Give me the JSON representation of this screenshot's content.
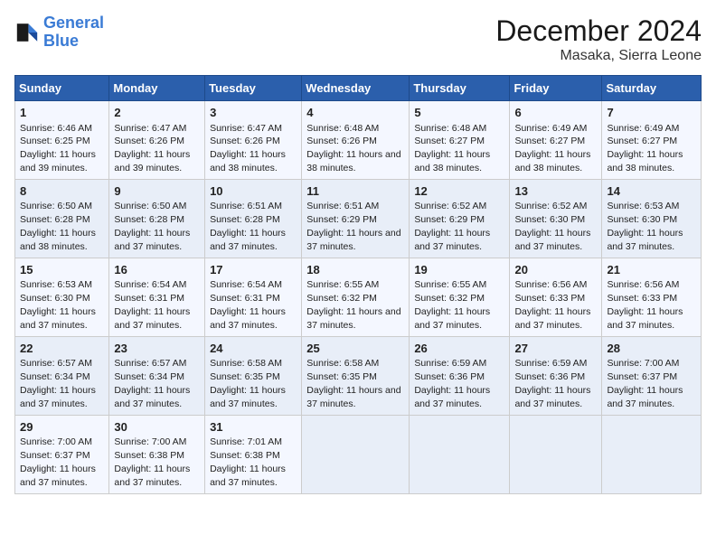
{
  "logo": {
    "line1": "General",
    "line2": "Blue"
  },
  "title": "December 2024",
  "subtitle": "Masaka, Sierra Leone",
  "headers": [
    "Sunday",
    "Monday",
    "Tuesday",
    "Wednesday",
    "Thursday",
    "Friday",
    "Saturday"
  ],
  "weeks": [
    [
      {
        "day": "1",
        "sunrise": "6:46 AM",
        "sunset": "6:25 PM",
        "daylight": "11 hours and 39 minutes."
      },
      {
        "day": "2",
        "sunrise": "6:47 AM",
        "sunset": "6:26 PM",
        "daylight": "11 hours and 39 minutes."
      },
      {
        "day": "3",
        "sunrise": "6:47 AM",
        "sunset": "6:26 PM",
        "daylight": "11 hours and 38 minutes."
      },
      {
        "day": "4",
        "sunrise": "6:48 AM",
        "sunset": "6:26 PM",
        "daylight": "11 hours and 38 minutes."
      },
      {
        "day": "5",
        "sunrise": "6:48 AM",
        "sunset": "6:27 PM",
        "daylight": "11 hours and 38 minutes."
      },
      {
        "day": "6",
        "sunrise": "6:49 AM",
        "sunset": "6:27 PM",
        "daylight": "11 hours and 38 minutes."
      },
      {
        "day": "7",
        "sunrise": "6:49 AM",
        "sunset": "6:27 PM",
        "daylight": "11 hours and 38 minutes."
      }
    ],
    [
      {
        "day": "8",
        "sunrise": "6:50 AM",
        "sunset": "6:28 PM",
        "daylight": "11 hours and 38 minutes."
      },
      {
        "day": "9",
        "sunrise": "6:50 AM",
        "sunset": "6:28 PM",
        "daylight": "11 hours and 37 minutes."
      },
      {
        "day": "10",
        "sunrise": "6:51 AM",
        "sunset": "6:28 PM",
        "daylight": "11 hours and 37 minutes."
      },
      {
        "day": "11",
        "sunrise": "6:51 AM",
        "sunset": "6:29 PM",
        "daylight": "11 hours and 37 minutes."
      },
      {
        "day": "12",
        "sunrise": "6:52 AM",
        "sunset": "6:29 PM",
        "daylight": "11 hours and 37 minutes."
      },
      {
        "day": "13",
        "sunrise": "6:52 AM",
        "sunset": "6:30 PM",
        "daylight": "11 hours and 37 minutes."
      },
      {
        "day": "14",
        "sunrise": "6:53 AM",
        "sunset": "6:30 PM",
        "daylight": "11 hours and 37 minutes."
      }
    ],
    [
      {
        "day": "15",
        "sunrise": "6:53 AM",
        "sunset": "6:30 PM",
        "daylight": "11 hours and 37 minutes."
      },
      {
        "day": "16",
        "sunrise": "6:54 AM",
        "sunset": "6:31 PM",
        "daylight": "11 hours and 37 minutes."
      },
      {
        "day": "17",
        "sunrise": "6:54 AM",
        "sunset": "6:31 PM",
        "daylight": "11 hours and 37 minutes."
      },
      {
        "day": "18",
        "sunrise": "6:55 AM",
        "sunset": "6:32 PM",
        "daylight": "11 hours and 37 minutes."
      },
      {
        "day": "19",
        "sunrise": "6:55 AM",
        "sunset": "6:32 PM",
        "daylight": "11 hours and 37 minutes."
      },
      {
        "day": "20",
        "sunrise": "6:56 AM",
        "sunset": "6:33 PM",
        "daylight": "11 hours and 37 minutes."
      },
      {
        "day": "21",
        "sunrise": "6:56 AM",
        "sunset": "6:33 PM",
        "daylight": "11 hours and 37 minutes."
      }
    ],
    [
      {
        "day": "22",
        "sunrise": "6:57 AM",
        "sunset": "6:34 PM",
        "daylight": "11 hours and 37 minutes."
      },
      {
        "day": "23",
        "sunrise": "6:57 AM",
        "sunset": "6:34 PM",
        "daylight": "11 hours and 37 minutes."
      },
      {
        "day": "24",
        "sunrise": "6:58 AM",
        "sunset": "6:35 PM",
        "daylight": "11 hours and 37 minutes."
      },
      {
        "day": "25",
        "sunrise": "6:58 AM",
        "sunset": "6:35 PM",
        "daylight": "11 hours and 37 minutes."
      },
      {
        "day": "26",
        "sunrise": "6:59 AM",
        "sunset": "6:36 PM",
        "daylight": "11 hours and 37 minutes."
      },
      {
        "day": "27",
        "sunrise": "6:59 AM",
        "sunset": "6:36 PM",
        "daylight": "11 hours and 37 minutes."
      },
      {
        "day": "28",
        "sunrise": "7:00 AM",
        "sunset": "6:37 PM",
        "daylight": "11 hours and 37 minutes."
      }
    ],
    [
      {
        "day": "29",
        "sunrise": "7:00 AM",
        "sunset": "6:37 PM",
        "daylight": "11 hours and 37 minutes."
      },
      {
        "day": "30",
        "sunrise": "7:00 AM",
        "sunset": "6:38 PM",
        "daylight": "11 hours and 37 minutes."
      },
      {
        "day": "31",
        "sunrise": "7:01 AM",
        "sunset": "6:38 PM",
        "daylight": "11 hours and 37 minutes."
      },
      null,
      null,
      null,
      null
    ]
  ]
}
